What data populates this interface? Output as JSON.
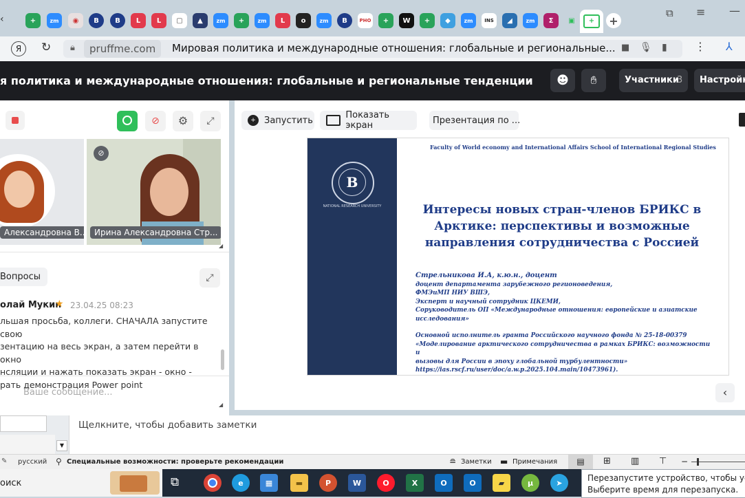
{
  "browser": {
    "url": "pruffme.com",
    "page_title": "Мировая политика и международные отношения: глобальные и региональные...",
    "tabs": [
      "zm",
      "zm",
      "zm",
      "zm",
      "zm",
      "zm",
      "zm"
    ]
  },
  "meeting": {
    "title": "я политика и международные отношения: глобальные и региональные тенденции",
    "participants_label": "Участники",
    "participants_count": "3",
    "settings_label": "Настройки"
  },
  "video": {
    "tiles": [
      {
        "name": "Александровна В..."
      },
      {
        "name": "Ирина Александровна Стр..."
      }
    ]
  },
  "questions": {
    "tab_label": "Вопросы",
    "message": {
      "author": "олай Мукин",
      "timestamp": "23.04.25 08:23",
      "lines": [
        "льшая просьба, коллеги. СНАЧАЛА запустите свою",
        "зентацию на весь экран, а затем перейти в окно",
        "нсляции и нажать показать экран - окно -",
        "рать демонстрация Power point"
      ]
    },
    "input_placeholder": "Ваше сообщение..."
  },
  "toolbar": {
    "start_label": "Запустить",
    "share_label": "Показать экран",
    "presentation_label": "Презентация по ..."
  },
  "slide": {
    "header": "Faculty of World economy and International Affairs School of International Regional Studies",
    "logo_caption": "NATIONAL RESEARCH UNIVERSITY",
    "title_lines": [
      "Интересы новых стран-членов БРИКС в",
      "Арктике: перспективы и возможные",
      "направления сотрудничества с Россией"
    ],
    "author_lines": [
      "Стрельникова И.А, к.ю.н., доцент",
      "доцент департамента зарубежного регионоведения,",
      "ФМЭиМП НИУ ВШЭ,",
      "Эксперт и научный сотрудник ЦКЕМИ,",
      "Соруководитель ОП «Международные отношения: европейские и азиатские",
      "исследования»"
    ],
    "grant_lines": [
      "Основной исполнитель гранта Российского научного фонда № 25-18-00379",
      "«Моделирование арктического сотрудничества в рамках БРИКС: возможности и",
      "вызовы для России в эпоху глобальной турбулентности»",
      " https://ias.rscf.ru/user/doc/a.w.p.2025.104.main/10473961)."
    ]
  },
  "powerpoint": {
    "notes_placeholder": "Щелкните, чтобы добавить заметки",
    "language": "русский",
    "accessibility": "Специальные возможности: проверьте рекомендации",
    "notes_btn": "Заметки",
    "comments_btn": "Примечания"
  },
  "taskbar": {
    "search_label": "оиск",
    "notification_line1": "Перезапустите устройство, чтобы установ",
    "notification_line2": "Выберите время для перезапуска."
  },
  "colors": {
    "accent_green": "#2fbf5a",
    "record_red": "#e84d4d",
    "slide_navy": "#22365c",
    "slide_blue_text": "#1f3c88"
  }
}
